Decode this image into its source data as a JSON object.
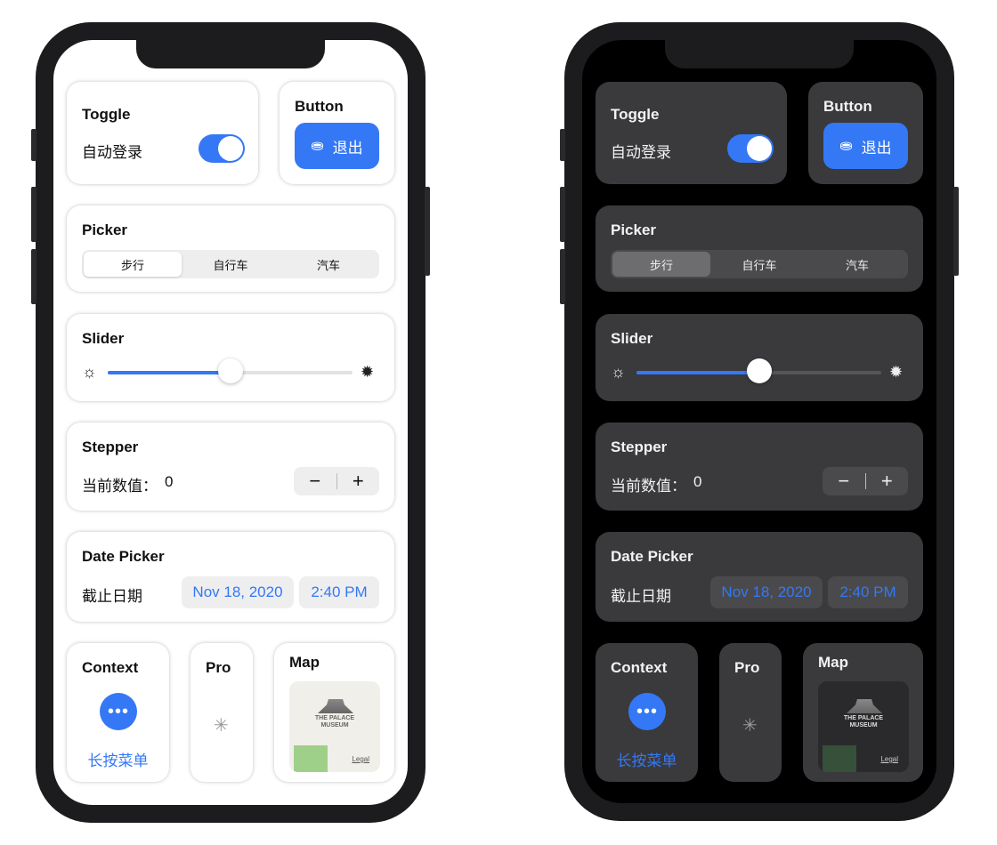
{
  "toggle": {
    "title": "Toggle",
    "label": "自动登录",
    "on": true
  },
  "button": {
    "title": "Button",
    "label": "退出",
    "icon": "person-badge-minus-icon"
  },
  "picker": {
    "title": "Picker",
    "options": [
      "步行",
      "自行车",
      "汽车"
    ],
    "selected": "步行"
  },
  "slider": {
    "title": "Slider",
    "value_percent": 50,
    "min_icon": "sun-min-icon",
    "max_icon": "sun-max-icon"
  },
  "stepper": {
    "title": "Stepper",
    "label": "当前数值：",
    "value": "0",
    "minus": "−",
    "plus": "+"
  },
  "date_picker": {
    "title": "Date Picker",
    "label": "截止日期",
    "date": "Nov 18, 2020",
    "time": "2:40 PM"
  },
  "context": {
    "title": "Context",
    "link": "长按菜单",
    "icon": "ellipsis-icon"
  },
  "pro": {
    "title": "Pro",
    "icon": "spinner-icon"
  },
  "map": {
    "title": "Map",
    "place_line1": "THE PALACE",
    "place_line2": "MUSEUM",
    "legal": "Legal"
  },
  "colors": {
    "accent": "#3478f6",
    "dark_card": "#3a3a3c"
  }
}
